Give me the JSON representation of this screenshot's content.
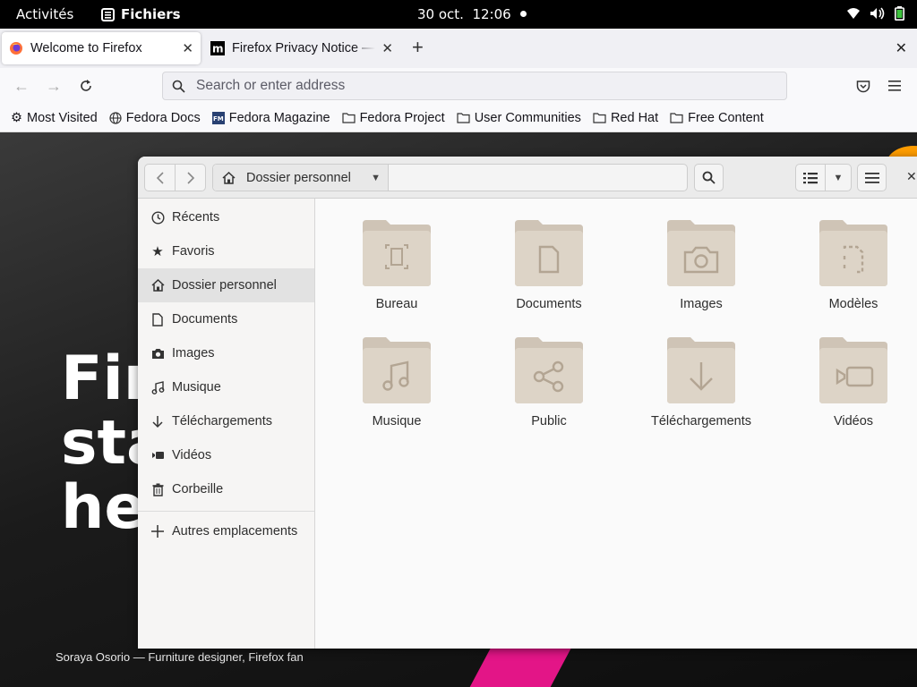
{
  "topbar": {
    "activities": "Activités",
    "app_name": "Fichiers",
    "clock": "30 oct.  12:06",
    "tray": [
      "wifi-icon",
      "volume-icon",
      "battery-icon"
    ]
  },
  "firefox": {
    "tabs": [
      {
        "title": "Welcome to Firefox",
        "icon": "firefox-icon",
        "active": true
      },
      {
        "title": "Firefox Privacy Notice — M",
        "icon": "mozilla-m-icon",
        "active": false
      }
    ],
    "url_placeholder": "Search or enter address",
    "bookmarks": [
      {
        "label": "Most Visited",
        "icon": "gear-icon"
      },
      {
        "label": "Fedora Docs",
        "icon": "globe-icon"
      },
      {
        "label": "Fedora Magazine",
        "icon": "fm-icon"
      },
      {
        "label": "Fedora Project",
        "icon": "folder-icon"
      },
      {
        "label": "User Communities",
        "icon": "folder-icon"
      },
      {
        "label": "Red Hat",
        "icon": "folder-icon"
      },
      {
        "label": "Free Content",
        "icon": "folder-icon"
      }
    ]
  },
  "page": {
    "hero_lines": [
      "Fir",
      "sta",
      "he"
    ],
    "caption": "Soraya Osorio — Furniture designer, Firefox fan"
  },
  "files": {
    "path": "Dossier personnel",
    "sidebar": [
      {
        "label": "Récents",
        "icon": "clock-icon"
      },
      {
        "label": "Favoris",
        "icon": "star-icon"
      },
      {
        "label": "Dossier personnel",
        "icon": "home-icon",
        "active": true
      },
      {
        "label": "Documents",
        "icon": "document-icon"
      },
      {
        "label": "Images",
        "icon": "camera-icon"
      },
      {
        "label": "Musique",
        "icon": "music-icon"
      },
      {
        "label": "Téléchargements",
        "icon": "download-icon"
      },
      {
        "label": "Vidéos",
        "icon": "video-icon"
      },
      {
        "label": "Corbeille",
        "icon": "trash-icon"
      },
      {
        "label": "Autres emplacements",
        "icon": "plus-icon"
      }
    ],
    "folders": [
      {
        "label": "Bureau",
        "icon": "desktop-folder-icon"
      },
      {
        "label": "Documents",
        "icon": "documents-folder-icon"
      },
      {
        "label": "Images",
        "icon": "pictures-folder-icon"
      },
      {
        "label": "Modèles",
        "icon": "templates-folder-icon"
      },
      {
        "label": "Musique",
        "icon": "music-folder-icon"
      },
      {
        "label": "Public",
        "icon": "public-folder-icon"
      },
      {
        "label": "Téléchargements",
        "icon": "downloads-folder-icon"
      },
      {
        "label": "Vidéos",
        "icon": "videos-folder-icon"
      }
    ]
  }
}
